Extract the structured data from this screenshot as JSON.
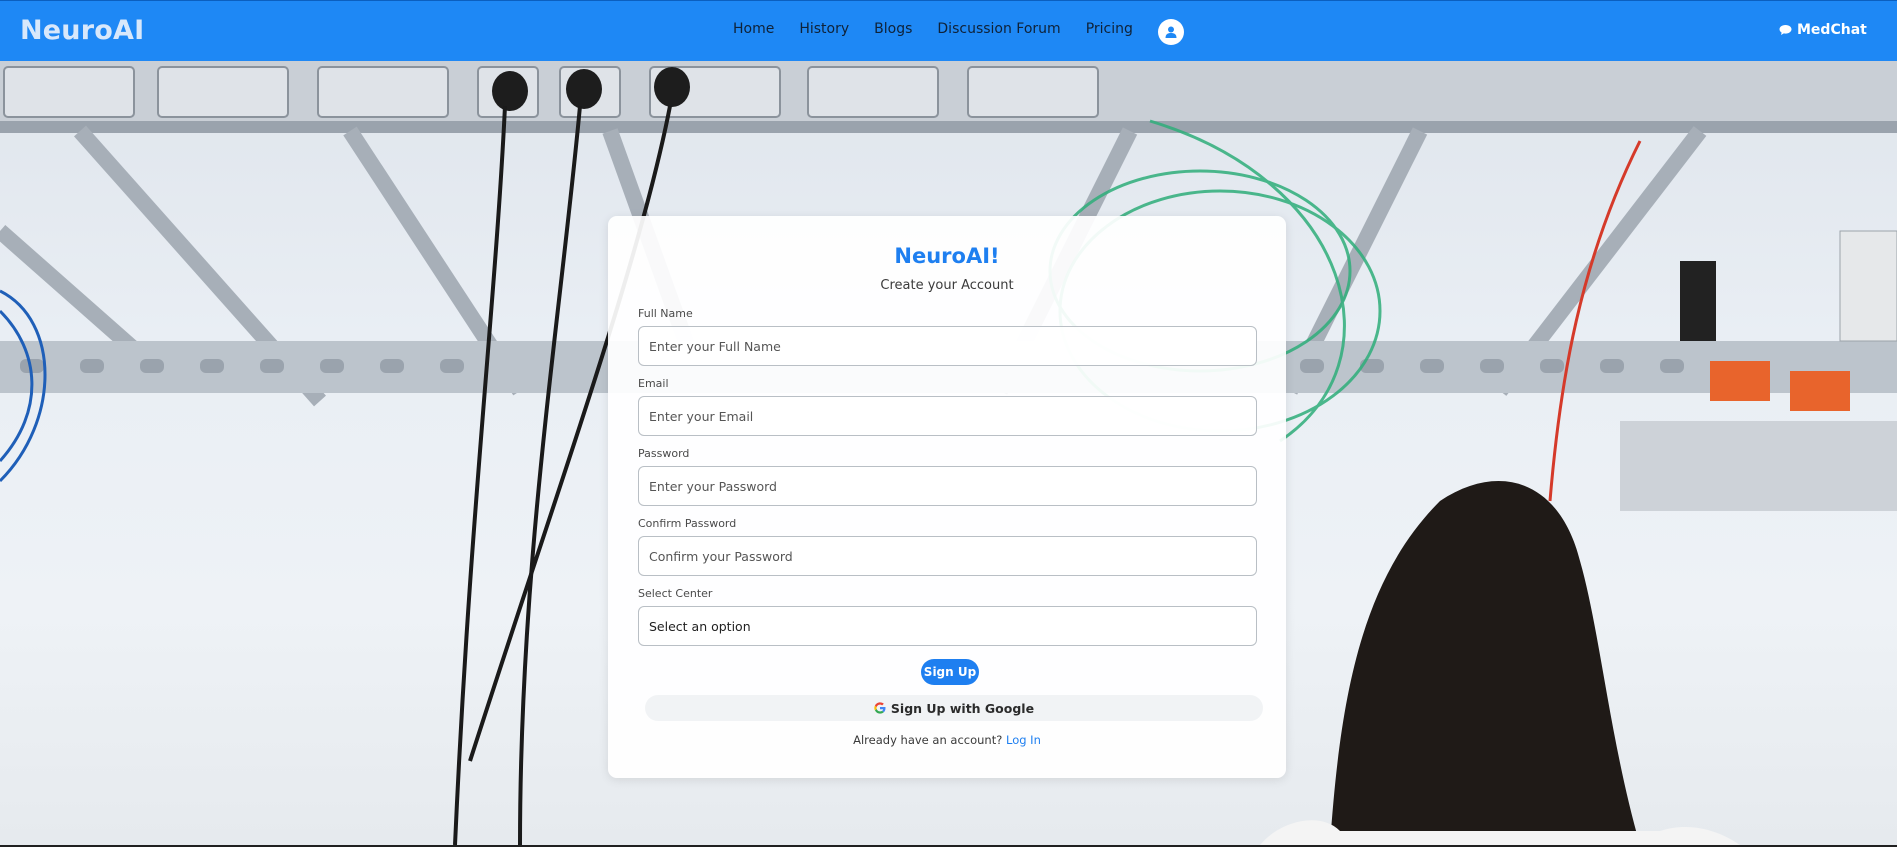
{
  "navbar": {
    "brand": "NeuroAI",
    "links": [
      "Home",
      "History",
      "Blogs",
      "Discussion Forum",
      "Pricing"
    ],
    "medchat_label": "MedChat"
  },
  "form": {
    "title": "NeuroAI!",
    "subtitle": "Create your Account",
    "fields": [
      {
        "label": "Full Name",
        "placeholder": "Enter your Full Name"
      },
      {
        "label": "Email",
        "placeholder": "Enter your Email"
      },
      {
        "label": "Password",
        "placeholder": "Enter your Password"
      },
      {
        "label": "Confirm Password",
        "placeholder": "Confirm your Password"
      }
    ],
    "select": {
      "label": "Select Center",
      "value": "Select an option"
    },
    "signup_label": "Sign Up",
    "google_label": "Sign Up with Google",
    "login_prompt": "Already have an account?",
    "login_link": "Log In"
  },
  "colors": {
    "navbar": "#1e88f5",
    "accent": "#1e7ff0"
  },
  "icons": {
    "avatar": "user-avatar-icon",
    "medchat": "chat-bubble-icon",
    "google": "google-logo-icon"
  }
}
